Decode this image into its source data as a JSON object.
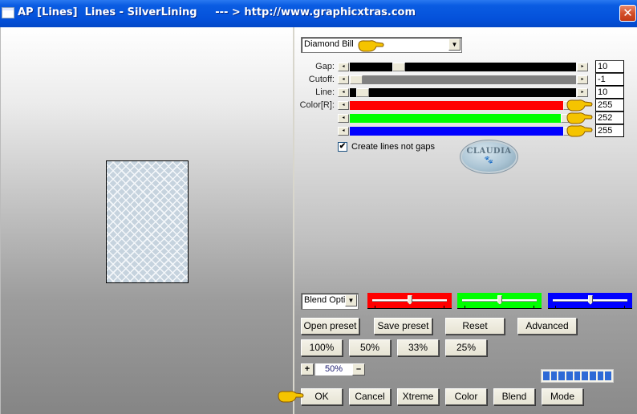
{
  "window": {
    "title": "AP [Lines]  Lines - SilverLining     --- > http://www.graphicxtras.com",
    "close_glyph": "✕"
  },
  "preset_select": {
    "value": "Diamond Bill",
    "arrow": "▼"
  },
  "sliders": [
    {
      "label": "Gap:",
      "value": "10",
      "track_color": "#000000",
      "position": 0.2
    },
    {
      "label": "Cutoff:",
      "value": "-1",
      "track_color": "#808080",
      "position": 0.0
    },
    {
      "label": "Line:",
      "value": "10",
      "track_color": "#000000",
      "position": 0.03
    },
    {
      "label": "Color[R]:",
      "value": "255",
      "track_color": "#ff0000",
      "position": 1.0
    },
    {
      "label": "",
      "value": "252",
      "track_color": "#00ff00",
      "position": 0.988
    },
    {
      "label": "",
      "value": "255",
      "track_color": "#0000ff",
      "position": 1.0
    }
  ],
  "slider_arrows": {
    "left": "◂",
    "right": "▸"
  },
  "checkbox": {
    "label": "Create lines not gaps",
    "checked": true,
    "glyph": "✔"
  },
  "logo": {
    "text": "CLAUDIA",
    "mark": "🐾"
  },
  "blend_select": {
    "value": "Blend Optio",
    "arrow": "▼"
  },
  "blend_sliders": [
    {
      "color": "#ff0000",
      "position": 0.5
    },
    {
      "color": "#00ff00",
      "position": 0.5
    },
    {
      "color": "#0000ff",
      "position": 0.5
    }
  ],
  "buttons_row1": [
    "Open preset",
    "Save preset",
    "Reset",
    "Advanced"
  ],
  "zoom_buttons": [
    "100%",
    "50%",
    "33%",
    "25%"
  ],
  "zoom_control": {
    "plus": "+",
    "value": "50%",
    "minus": "–"
  },
  "progress": {
    "segments": 9,
    "filled": 9
  },
  "bottom_buttons": [
    "OK",
    "Cancel",
    "Xtreme",
    "Color",
    "Blend",
    "Mode"
  ]
}
